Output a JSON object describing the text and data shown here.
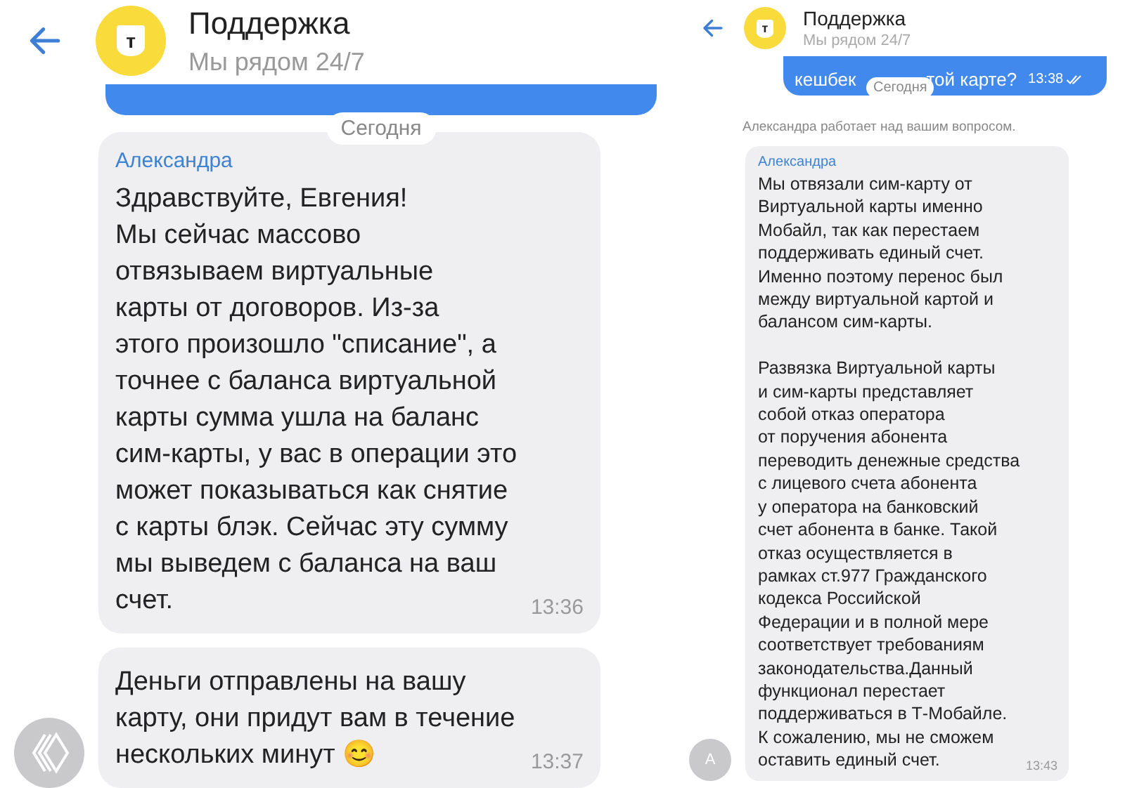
{
  "panels": [
    {
      "header": {
        "title": "Поддержка",
        "subtitle": "Мы рядом 24/7",
        "logo_letter": "т"
      },
      "date_pill": "Сегодня",
      "messages": [
        {
          "sender": "Александра",
          "text": "Здравствуйте, Евгения!\nМы сейчас массово\nотвязываем виртуальные\nкарты от договоров. Из-за\nэтого произошло \"списание\", а\nточнее с баланса виртуальной\nкарты сумма ушла на баланс\nсим-карты, у вас в операции это\nможет показываться как снятие\nс карты блэк. Сейчас эту сумму\nмы выведем с баланса на ваш\nсчет.",
          "time": "13:36"
        },
        {
          "text": "Деньги отправлены на вашу\nкарту, они придут вам в течение\nнескольких минут 😊",
          "time": "13:37"
        }
      ],
      "avatar": {
        "kind": "logo"
      }
    },
    {
      "header": {
        "title": "Поддержка",
        "subtitle": "Мы рядом 24/7",
        "logo_letter": "т"
      },
      "top_bubble": {
        "visible_before": "кешбек",
        "visible_after": "той карте?",
        "time": "13:38"
      },
      "date_pill": "Сегодня",
      "status": "Александра работает над вашим вопросом.",
      "messages": [
        {
          "sender": "Александра",
          "text": "Мы отвязали сим-карту от\nВиртуальной карты именно\nМобайл, так как перестаем\nподдерживать единый счет.\nИменно поэтому перенос был\nмежду виртуальной картой и\nбалансом сим-карты.\n\nРазвязка Виртуальной карты\nи сим-карты представляет\nсобой отказ оператора\nот поручения абонента\nпереводить денежные средства\nс лицевого счета абонента\nу оператора на банковский\nсчет абонента в банке. Такой\nотказ осуществляется в\nрамках ст.977 Гражданского\nкодекса Российской\nФедерации и в полной мере\nсоответствует требованиям\nзаконодательства.Данный\nфункционал перестает\nподдерживаться в Т-Мобайле.\nК сожалению, мы не сможем\nоставить единый счет.",
          "time": "13:43"
        }
      ],
      "avatar": {
        "kind": "letter",
        "letter": "А"
      }
    }
  ]
}
